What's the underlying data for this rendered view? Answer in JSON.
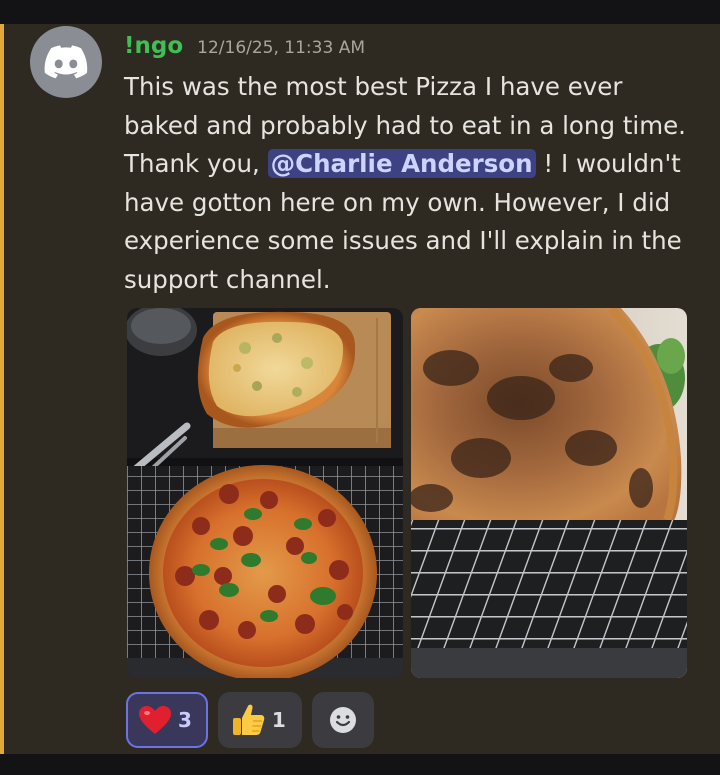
{
  "message": {
    "username": "!ngo",
    "timestamp": "12/16/25, 11:33 AM",
    "text_before": "This was the most best Pizza I have ever baked and probably had to eat in a long time. Thank you, ",
    "mention": "@Charlie Anderson",
    "text_after": " ! I wouldn't have gotton here on my own. However, I did experience some issues and I'll explain in the support channel.",
    "avatar_icon": "discord-logo-icon",
    "attachments": [
      {
        "name": "pizza-photo-overhead",
        "description": "two pizzas on board and wire rack"
      },
      {
        "name": "pizza-photo-underside",
        "description": "charred crust on wire rack"
      }
    ]
  },
  "reactions": [
    {
      "emoji": "heart",
      "count": "3",
      "active": true
    },
    {
      "emoji": "thumbs-up",
      "count": "1",
      "active": false
    }
  ],
  "add_reaction_icon": "smiley-icon",
  "colors": {
    "background": "#2e2a22",
    "mention_stripe": "#e2a83a",
    "username": "#3fbf55",
    "mention_bg": "#3d4283",
    "reaction_active_border": "#6d72e6"
  }
}
